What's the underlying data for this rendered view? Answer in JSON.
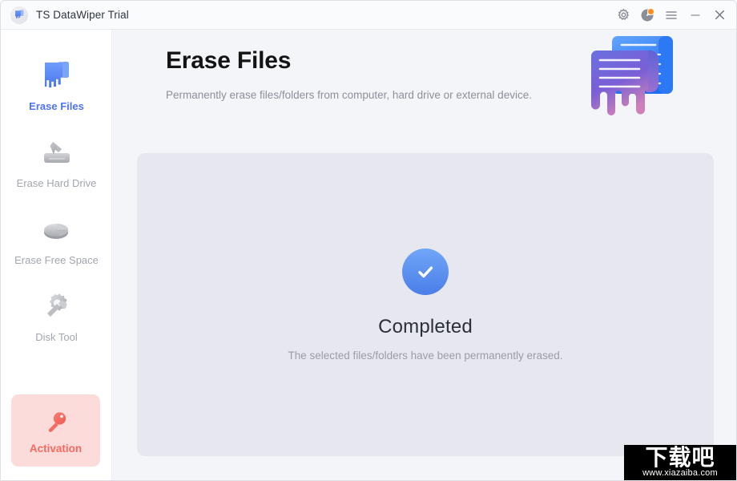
{
  "window": {
    "title": "TS DataWiper Trial",
    "app_icon": "datawiper-logo-icon",
    "controls": [
      {
        "name": "settings-button",
        "icon": "gear-icon"
      },
      {
        "name": "trial-status-button",
        "icon": "clock-icon",
        "badge": true
      },
      {
        "name": "menu-button",
        "icon": "hamburger-icon"
      },
      {
        "name": "minimize-button",
        "icon": "minimize-icon"
      },
      {
        "name": "close-button",
        "icon": "close-icon"
      }
    ]
  },
  "sidebar": {
    "items": [
      {
        "label": "Erase Files",
        "icon": "melting-document-icon",
        "active": true
      },
      {
        "label": "Erase Hard Drive",
        "icon": "hard-drive-arrow-icon",
        "active": false
      },
      {
        "label": "Erase Free Space",
        "icon": "pie-chart-icon",
        "active": false
      },
      {
        "label": "Disk Tool",
        "icon": "gear-wrench-icon",
        "active": false
      }
    ],
    "activation": {
      "label": "Activation",
      "icon": "key-icon"
    }
  },
  "main": {
    "title": "Erase Files",
    "subtitle": "Permanently erase files/folders from computer, hard drive or external device.",
    "header_art": "melting-documents-illustration",
    "status": {
      "icon": "check-circle-icon",
      "title": "Completed",
      "description": "The selected files/folders have been permanently erased."
    }
  },
  "watermark": {
    "text_cn": "下载吧",
    "url": "www.xiazaiba.com"
  },
  "colors": {
    "accent_blue": "#4f73f5",
    "activation_bg": "#fcdcdb",
    "activation_fg": "#f26a61",
    "page_bg": "#f4f5f9",
    "card_bg": "#e7e7ef",
    "badge_orange": "#ff8b1f"
  }
}
